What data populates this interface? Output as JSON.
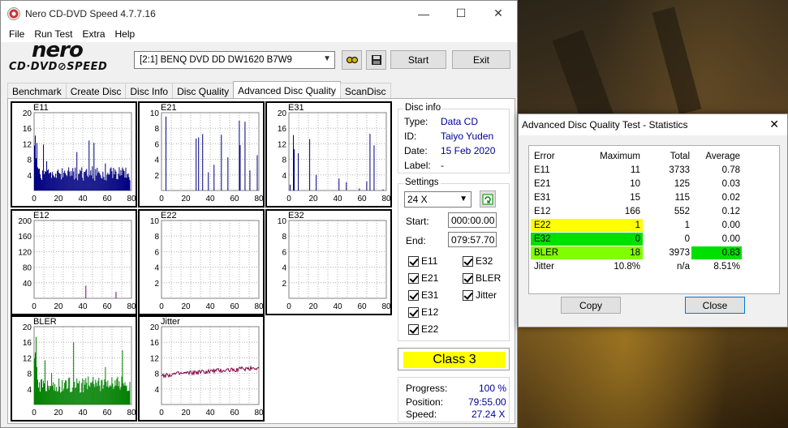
{
  "window": {
    "title": "Nero CD-DVD Speed 4.7.7.16",
    "controls": {
      "minimize": "—",
      "maximize": "☐",
      "close": "✕"
    }
  },
  "menu": [
    "File",
    "Run Test",
    "Extra",
    "Help"
  ],
  "logo": {
    "word": "nero",
    "sub": "CD·DVD⊘SPEED"
  },
  "toolbar": {
    "drive": "[2:1]   BENQ DVD DD DW1620 B7W9",
    "start": "Start",
    "exit": "Exit"
  },
  "tabs": [
    "Benchmark",
    "Create Disc",
    "Disc Info",
    "Disc Quality",
    "Advanced Disc Quality",
    "ScanDisc"
  ],
  "active_tab": "Advanced Disc Quality",
  "disc_info": {
    "title": "Disc info",
    "rows": [
      {
        "label": "Type:",
        "value": "Data CD"
      },
      {
        "label": "ID:",
        "value": "Taiyo Yuden"
      },
      {
        "label": "Date:",
        "value": "15 Feb 2020"
      },
      {
        "label": "Label:",
        "value": "-"
      }
    ]
  },
  "settings": {
    "title": "Settings",
    "speed": "24 X",
    "start_label": "Start:",
    "start_value": "000:00.00",
    "end_label": "End:",
    "end_value": "079:57.70",
    "checks_left": [
      "E11",
      "E21",
      "E31",
      "E12",
      "E22"
    ],
    "checks_right": [
      "E32",
      "BLER",
      "Jitter"
    ]
  },
  "class": "Class 3",
  "progress": {
    "rows": [
      {
        "label": "Progress:",
        "value": "100 %"
      },
      {
        "label": "Position:",
        "value": "79:55.00"
      },
      {
        "label": "Speed:",
        "value": "27.24 X"
      }
    ]
  },
  "graph_labels": {
    "e11": "E11",
    "e21": "E21",
    "e31": "E31",
    "e12": "E12",
    "e22": "E22",
    "e32": "E32",
    "bler": "BLER",
    "jitter": "Jitter"
  },
  "chart_data": [
    {
      "type": "bar",
      "title": "E11",
      "ylim": [
        0,
        20
      ],
      "yticks": [
        "20",
        "16",
        "12",
        "8",
        "4"
      ],
      "xticks": [
        "0",
        "20",
        "40",
        "60",
        "80"
      ],
      "xlim": [
        0,
        80
      ],
      "color": "#000080",
      "profile": "dense",
      "base": 2.5,
      "peak": 15
    },
    {
      "type": "bar",
      "title": "E21",
      "ylim": [
        0,
        10
      ],
      "yticks": [
        "10",
        "8",
        "6",
        "4",
        "2"
      ],
      "xticks": [
        "0",
        "20",
        "40",
        "60",
        "80"
      ],
      "xlim": [
        0,
        80
      ],
      "color": "#000080",
      "profile": "sparse",
      "base": 0,
      "peak": 10
    },
    {
      "type": "bar",
      "title": "E31",
      "ylim": [
        0,
        20
      ],
      "yticks": [
        "20",
        "16",
        "12",
        "8",
        "4"
      ],
      "xticks": [
        "0",
        "20",
        "40",
        "60",
        "80"
      ],
      "xlim": [
        0,
        80
      ],
      "color": "#000080",
      "profile": "sparse",
      "base": 0,
      "peak": 15
    },
    {
      "type": "bar",
      "title": "E12",
      "ylim": [
        0,
        200
      ],
      "yticks": [
        "200",
        "160",
        "120",
        "80",
        "40"
      ],
      "xticks": [
        "0",
        "20",
        "40",
        "60",
        "80"
      ],
      "xlim": [
        0,
        80
      ],
      "color": "#800080",
      "profile": "rare",
      "base": 0,
      "peak": 166
    },
    {
      "type": "bar",
      "title": "E22",
      "ylim": [
        0,
        10
      ],
      "yticks": [
        "10",
        "8",
        "6",
        "4",
        "2"
      ],
      "xticks": [
        "0",
        "20",
        "40",
        "60",
        "80"
      ],
      "xlim": [
        0,
        80
      ],
      "color": "#800080",
      "profile": "none",
      "base": 0,
      "peak": 1
    },
    {
      "type": "bar",
      "title": "E32",
      "ylim": [
        0,
        10
      ],
      "yticks": [
        "10",
        "8",
        "6",
        "4",
        "2"
      ],
      "xticks": [
        "0",
        "20",
        "40",
        "60",
        "80"
      ],
      "xlim": [
        0,
        80
      ],
      "color": "#800080",
      "profile": "none",
      "base": 0,
      "peak": 0
    },
    {
      "type": "bar",
      "title": "BLER",
      "ylim": [
        0,
        20
      ],
      "yticks": [
        "20",
        "16",
        "12",
        "8",
        "4"
      ],
      "xticks": [
        "0",
        "20",
        "40",
        "60",
        "80"
      ],
      "xlim": [
        0,
        80
      ],
      "color": "#008000",
      "profile": "dense",
      "base": 3,
      "peak": 18
    },
    {
      "type": "line",
      "title": "Jitter",
      "ylim": [
        0,
        20
      ],
      "yticks": [
        "20",
        "16",
        "12",
        "8",
        "4"
      ],
      "xticks": [
        "0",
        "20",
        "40",
        "60",
        "80"
      ],
      "xlim": [
        0,
        80
      ],
      "color": "#800040",
      "start": 7.5,
      "end": 9.5
    }
  ],
  "stats": {
    "title": "Advanced Disc Quality Test - Statistics",
    "headers": [
      "Error",
      "Maximum",
      "Total",
      "Average"
    ],
    "rows": [
      {
        "name": "E11",
        "max": "11",
        "total": "3733",
        "avg": "0.78",
        "hl_name": "",
        "hl_avg": ""
      },
      {
        "name": "E21",
        "max": "10",
        "total": "125",
        "avg": "0.03",
        "hl_name": "",
        "hl_avg": ""
      },
      {
        "name": "E31",
        "max": "15",
        "total": "115",
        "avg": "0.02",
        "hl_name": "",
        "hl_avg": ""
      },
      {
        "name": "E12",
        "max": "166",
        "total": "552",
        "avg": "0.12",
        "hl_name": "",
        "hl_avg": ""
      },
      {
        "name": "E22",
        "max": "1",
        "total": "1",
        "avg": "0.00",
        "hl_name": "#ffff00",
        "hl_avg": ""
      },
      {
        "name": "E32",
        "max": "0",
        "total": "0",
        "avg": "0.00",
        "hl_name": "#00e000",
        "hl_avg": ""
      },
      {
        "name": "BLER",
        "max": "18",
        "total": "3973",
        "avg": "0.83",
        "hl_name": "#80ff00",
        "hl_avg": "#00e000"
      },
      {
        "name": "Jitter",
        "max": "10.8%",
        "total": "n/a",
        "avg": "8.51%",
        "hl_name": "",
        "hl_avg": ""
      }
    ],
    "copy": "Copy",
    "close": "Close"
  }
}
